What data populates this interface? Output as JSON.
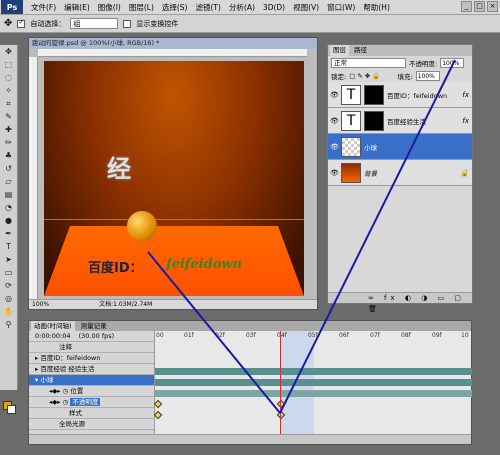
{
  "menubar": {
    "logo": "Ps",
    "items": [
      "文件(F)",
      "编辑(E)",
      "图像(I)",
      "图层(L)",
      "选择(S)",
      "滤镜(T)",
      "分析(A)",
      "3D(D)",
      "视图(V)",
      "窗口(W)",
      "帮助(H)"
    ],
    "min": "_",
    "max": "□",
    "close": "×"
  },
  "options": {
    "auto_select_label": "自动选择：",
    "auto_select_value": "组",
    "show_transform_label": "显示变换控件"
  },
  "document": {
    "title": "跳动的旋律.psd @ 100%(小球, RGB/16) *",
    "canvas_text_big": "经",
    "canvas_text_baidu": "百度ID：",
    "canvas_text_id": "feifeidown",
    "zoom": "100%",
    "doc_info": "文档:1.03M/2.74M"
  },
  "layers_panel": {
    "tabs": [
      "图层",
      "路径"
    ],
    "blend_mode": "正常",
    "opacity_label": "不透明度:",
    "opacity_value": "100%",
    "lock_label": "锁定:",
    "fill_label": "填充:",
    "fill_value": "100%",
    "layers": [
      {
        "name": "百度ID：feifeidown",
        "fx": "fx"
      },
      {
        "name": "百度经验生活",
        "fx": "fx"
      },
      {
        "name": "小球",
        "fx": ""
      },
      {
        "name": "背景",
        "fx": ""
      }
    ],
    "footer_icons": "∞ fx ◐ ◑ ▭ ▢ 🗑"
  },
  "animation_panel": {
    "tabs": [
      "动画(时间轴)",
      "测量记录"
    ],
    "time": "0:00:00:04",
    "fps": "(30.00 fps)",
    "rows": [
      "注释",
      "百度ID：feifeidown",
      "百度经验 经验生活",
      "小球",
      "位置",
      "不透明度",
      "样式",
      "全局光源"
    ],
    "ticks": [
      "00",
      "01f",
      "02f",
      "03f",
      "04f",
      "05f",
      "06f",
      "07f",
      "08f",
      "09f",
      "10"
    ]
  }
}
